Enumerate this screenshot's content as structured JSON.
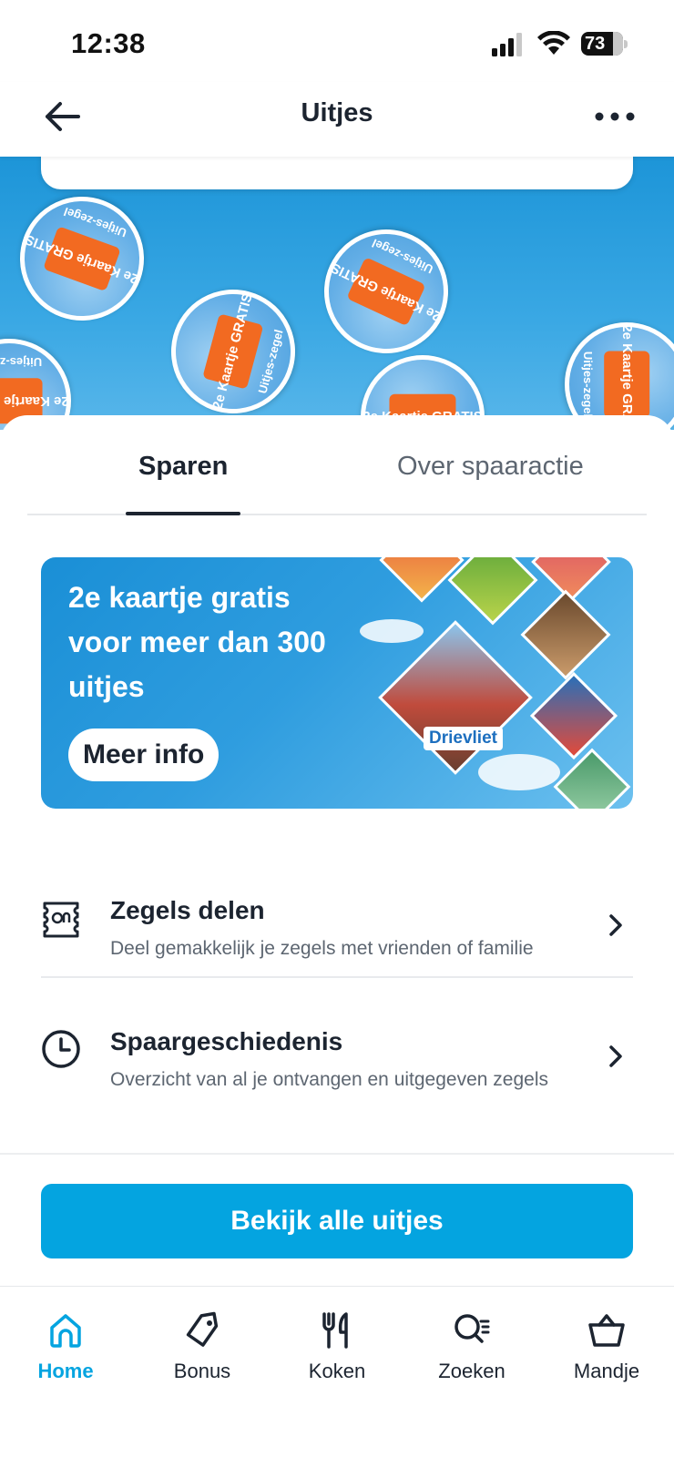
{
  "status_bar": {
    "time": "12:38",
    "battery": "73"
  },
  "header": {
    "title": "Uitjes",
    "back_icon": "arrow-left-icon",
    "more_icon": "more-horizontal-icon"
  },
  "hero": {
    "stamp_ticket_text": "2e Kaartje GRATIS",
    "stamp_ring_text": "Uitjes-zegel"
  },
  "tabs": [
    {
      "label": "Sparen",
      "active": true
    },
    {
      "label": "Over spaaractie",
      "active": false
    }
  ],
  "promo": {
    "text": "2e kaartje gratis voor meer dan 300 uitjes",
    "button_label": "Meer info",
    "park_label": "Drievliet"
  },
  "list": [
    {
      "icon": "stamp-icon",
      "title": "Zegels delen",
      "subtitle": "Deel gemakkelijk je zegels met vrienden of familie"
    },
    {
      "icon": "clock-icon",
      "title": "Spaargeschiedenis",
      "subtitle": "Overzicht van al je ontvangen en uitgegeven zegels"
    }
  ],
  "cta": {
    "label": "Bekijk alle uitjes"
  },
  "bottom_nav": [
    {
      "label": "Home",
      "icon": "home-icon",
      "active": true
    },
    {
      "label": "Bonus",
      "icon": "tag-icon",
      "active": false
    },
    {
      "label": "Koken",
      "icon": "cutlery-icon",
      "active": false
    },
    {
      "label": "Zoeken",
      "icon": "search-icon",
      "active": false
    },
    {
      "label": "Mandje",
      "icon": "basket-icon",
      "active": false
    }
  ],
  "colors": {
    "accent": "#04a4e0",
    "ticket": "#f26a21",
    "text": "#1c2430",
    "muted": "#5d6671"
  }
}
